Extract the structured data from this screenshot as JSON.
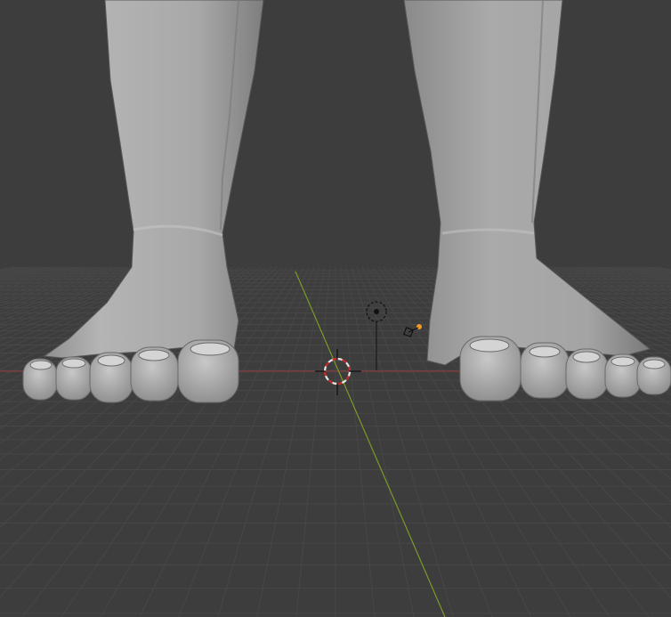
{
  "viewport": {
    "background": "#3d3d3d",
    "grid_color": "#474747",
    "x_axis_color": "#9b3a3a",
    "y_axis_color": "#7a9a2a",
    "mesh_color": "#9e9e9e",
    "selection_color": "#f19a2a",
    "icons": {
      "cursor": "3d-cursor-icon",
      "empty": "empty-object-icon",
      "light": "light-object-icon"
    }
  }
}
